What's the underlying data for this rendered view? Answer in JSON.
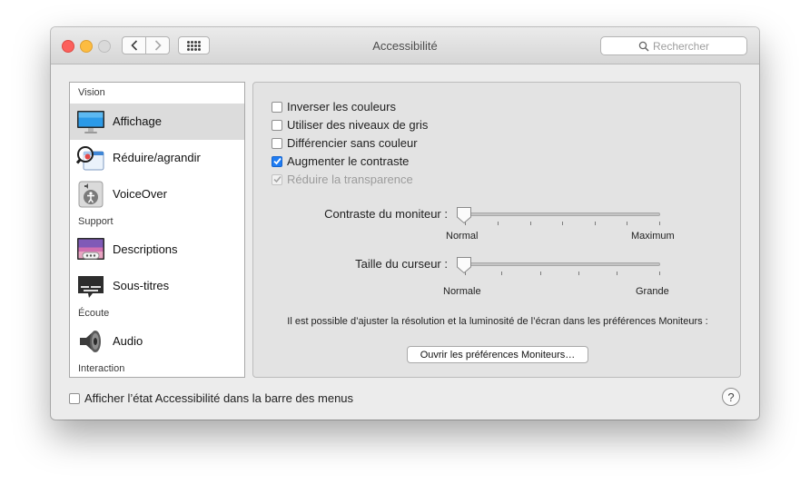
{
  "window": {
    "title": "Accessibilité",
    "search_placeholder": "Rechercher"
  },
  "sidebar": {
    "sections": [
      {
        "label": "Vision"
      },
      {
        "label": "Support"
      },
      {
        "label": "Écoute"
      },
      {
        "label": "Interaction"
      }
    ],
    "items": [
      {
        "label": "Affichage",
        "icon": "display-icon",
        "selected": true
      },
      {
        "label": "Réduire/agrandir",
        "icon": "zoom-icon"
      },
      {
        "label": "VoiceOver",
        "icon": "voiceover-icon"
      },
      {
        "label": "Descriptions",
        "icon": "descriptions-icon"
      },
      {
        "label": "Sous-titres",
        "icon": "subtitles-icon"
      },
      {
        "label": "Audio",
        "icon": "speaker-icon"
      }
    ]
  },
  "display": {
    "checkboxes": [
      {
        "label": "Inverser les couleurs",
        "checked": false
      },
      {
        "label": "Utiliser des niveaux de gris",
        "checked": false
      },
      {
        "label": "Différencier sans couleur",
        "checked": false
      },
      {
        "label": "Augmenter le contraste",
        "checked": true
      },
      {
        "label": "Réduire la transparence",
        "checked": true,
        "disabled": true
      }
    ],
    "contrast_slider": {
      "label": "Contraste du moniteur :",
      "min_label": "Normal",
      "max_label": "Maximum",
      "value": 0
    },
    "cursor_slider": {
      "label": "Taille du curseur :",
      "min_label": "Normale",
      "max_label": "Grande",
      "value": 0
    },
    "info_text": "Il est possible d’ajuster la résolution et la luminosité de l’écran dans les préférences Moniteurs :",
    "open_button": "Ouvrir les préférences Moniteurs…"
  },
  "footer": {
    "menubar_checkbox": {
      "label": "Afficher l’état Accessibilité dans la barre des menus",
      "checked": false
    },
    "help": "?"
  },
  "colors": {
    "accent": "#1f7cf2",
    "selection": "#dcdcdc"
  }
}
